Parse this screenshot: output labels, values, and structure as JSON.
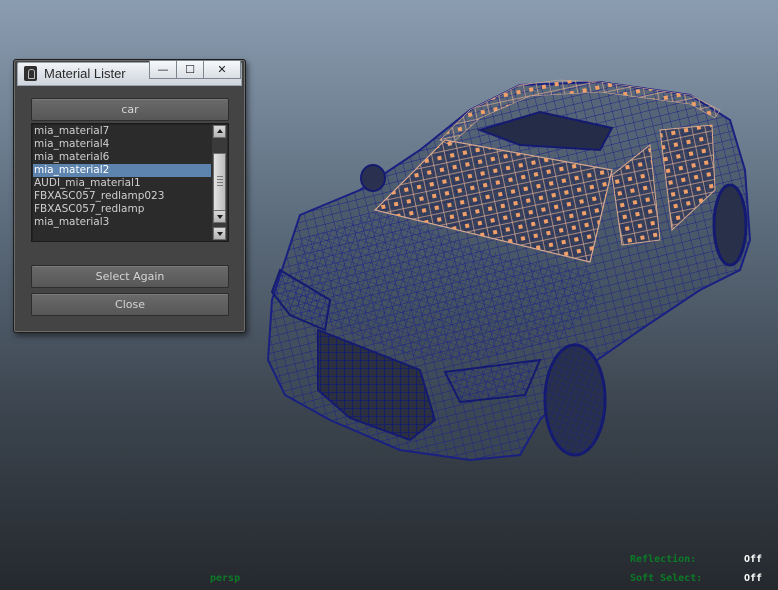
{
  "window": {
    "title": "Material Lister",
    "caption_buttons": {
      "minimize": "—",
      "maximize": "☐",
      "close": "✕"
    },
    "group_button_label": "car",
    "materials": [
      "mia_material7",
      "mia_material4",
      "mia_material6",
      "mia_material2",
      "AUDI_mia_material1",
      "FBXASC057_redlamp023",
      "FBXASC057_redlamp",
      "mia_material3"
    ],
    "selected_index": 3,
    "select_again_label": "Select Again",
    "close_label": "Close"
  },
  "viewport": {
    "camera_label": "persp",
    "hud": [
      {
        "label": "Reflection:",
        "value": "Off"
      },
      {
        "label": "Soft Select:",
        "value": "Off"
      }
    ]
  },
  "colors": {
    "wireframe": "#1f2a8c",
    "selected_vertices": "#f0a068",
    "selection_highlight": "#5d84ae",
    "hud_label": "#0b7a26"
  }
}
